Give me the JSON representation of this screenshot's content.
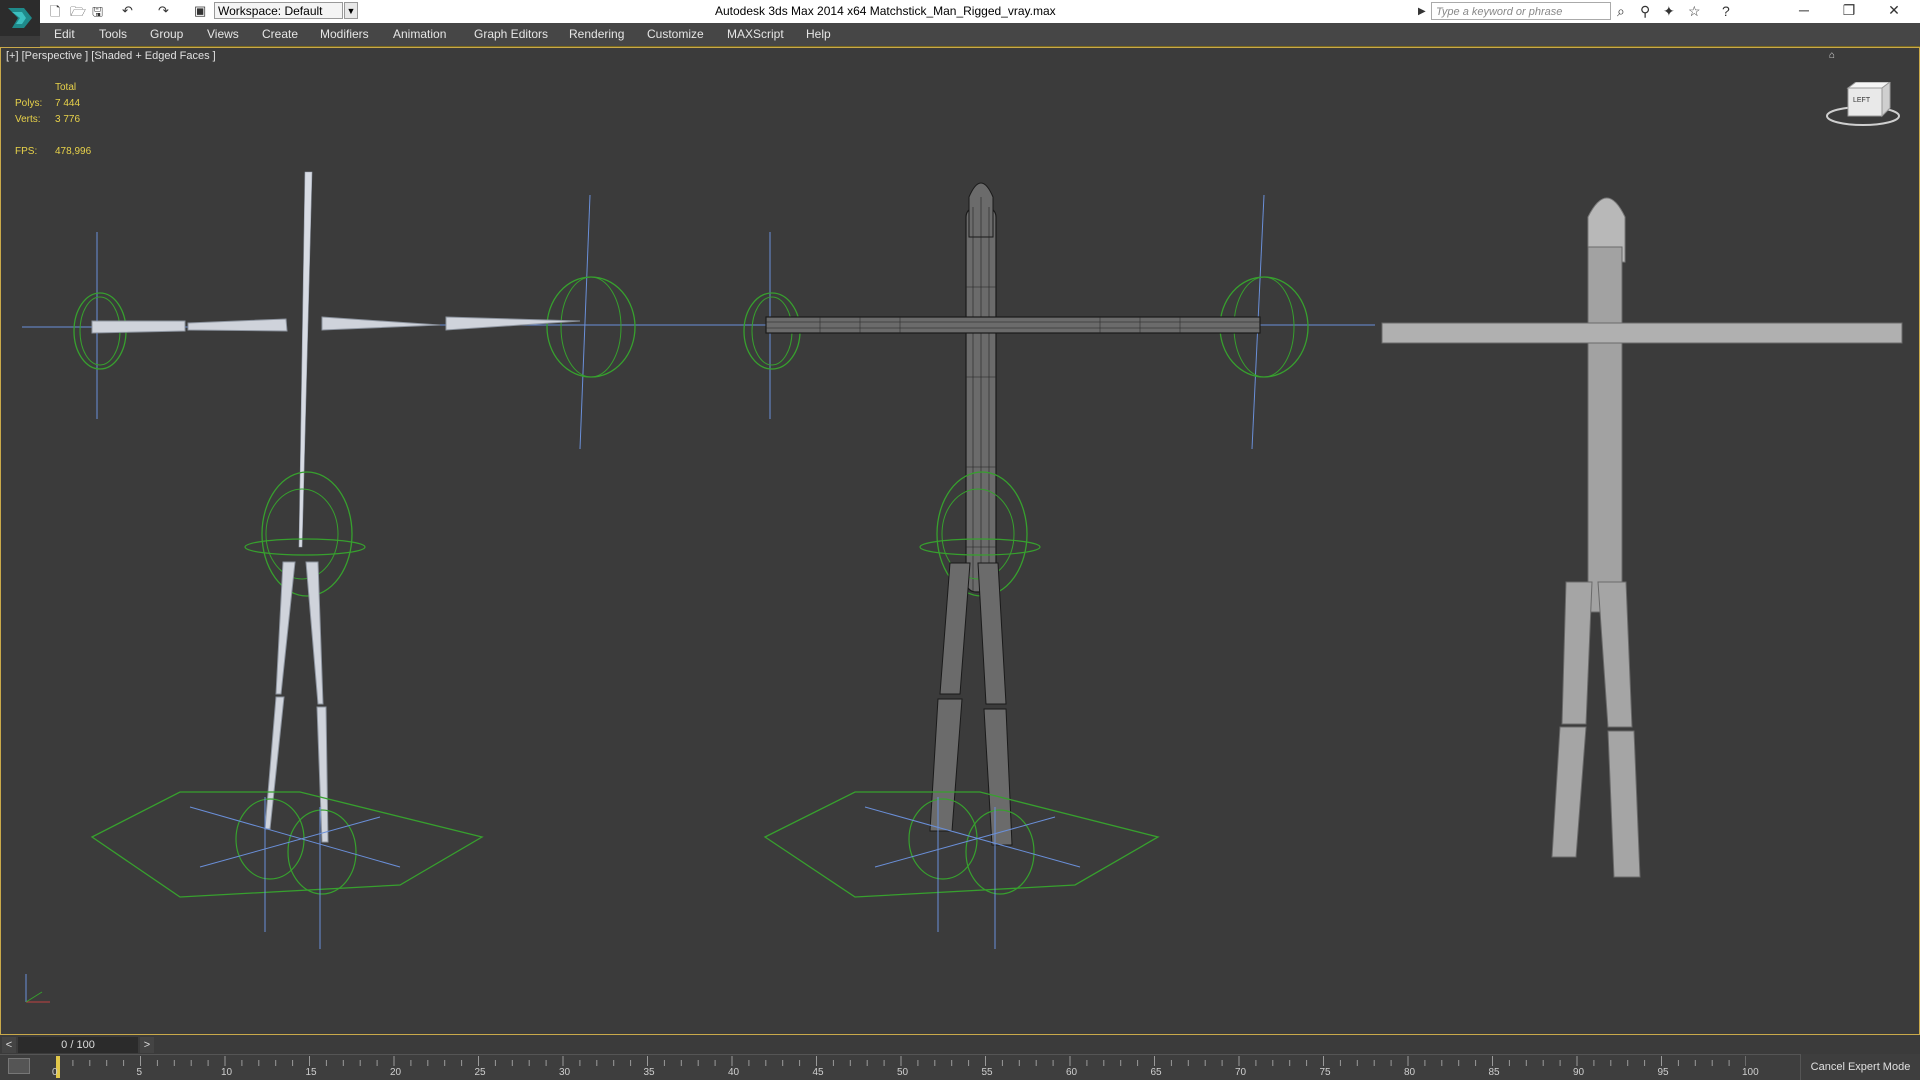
{
  "app": {
    "title": "Autodesk 3ds Max  2014 x64     Matchstick_Man_Rigged_vray.max",
    "workspace_label": "Workspace: Default",
    "search_placeholder": "Type a keyword or phrase"
  },
  "menu": {
    "items": [
      "Edit",
      "Tools",
      "Group",
      "Views",
      "Create",
      "Modifiers",
      "Animation",
      "Graph Editors",
      "Rendering",
      "Customize",
      "MAXScript",
      "Help"
    ]
  },
  "viewport": {
    "label": "[+] [Perspective ] [Shaded + Edged Faces ]",
    "stats": {
      "header": "Total",
      "polys_label": "Polys:",
      "polys_value": "7 444",
      "verts_label": "Verts:",
      "verts_value": "3 776",
      "fps_label": "FPS:",
      "fps_value": "478,996"
    },
    "viewcube_text": "LEFT"
  },
  "timeline": {
    "frame_counter": "0 / 100",
    "prev": "<",
    "next": ">",
    "ticks": [
      "0",
      "5",
      "10",
      "15",
      "20",
      "25",
      "30",
      "35",
      "40",
      "45",
      "50",
      "55",
      "60",
      "65",
      "70",
      "75",
      "80",
      "85",
      "90",
      "95",
      "100"
    ],
    "expert_mode": "Cancel Expert Mode"
  },
  "colors": {
    "viewport_bg": "#3b3b3b",
    "stats_yellow": "#e8d24a",
    "rig_green": "#37a02e",
    "axis_blue": "#6a8fd8"
  }
}
